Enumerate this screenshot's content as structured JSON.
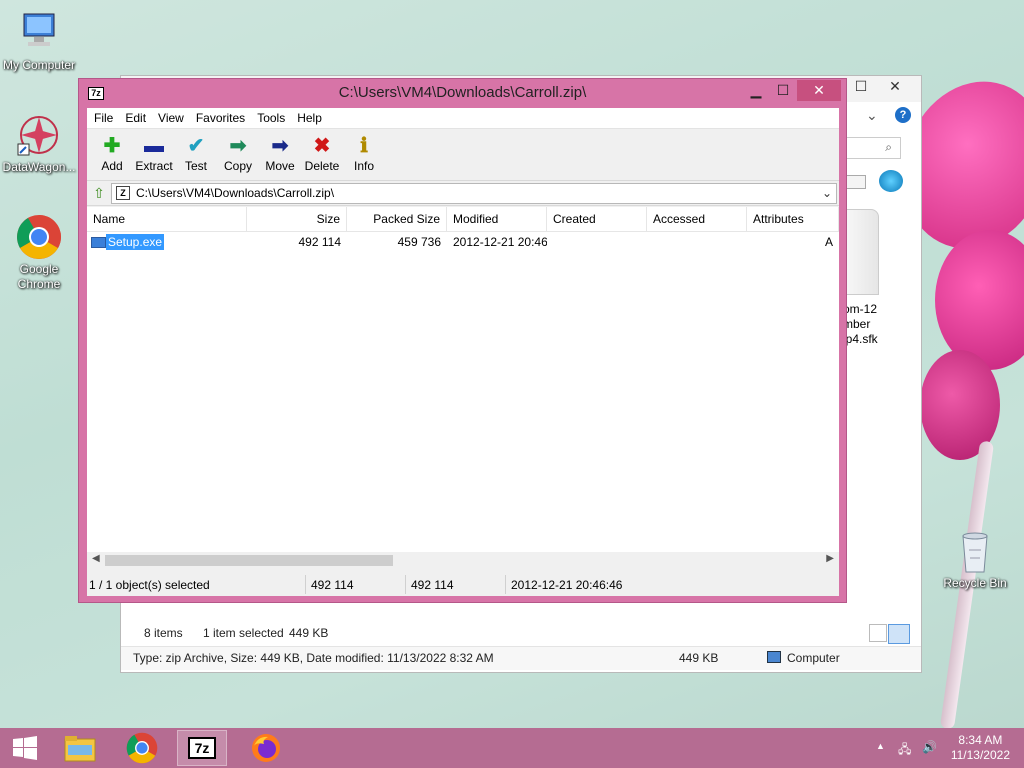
{
  "desktop": {
    "icons": [
      {
        "label": "My Computer",
        "icon": "computer-icon"
      },
      {
        "label": "DataWagon...",
        "icon": "datawagon-icon"
      },
      {
        "label": "Google Chrome",
        "icon": "chrome-icon"
      },
      {
        "label": "Recycle Bin",
        "icon": "recycle-bin-icon"
      }
    ]
  },
  "explorer": {
    "behind_text": [
      "om-12",
      "mber",
      "ip4.sfk"
    ],
    "status_items": "8 items",
    "status_selected": "1 item selected",
    "status_size": "449 KB",
    "details_text": "Type: zip Archive, Size: 449 KB, Date modified: 11/13/2022 8:32 AM",
    "details_size": "449 KB",
    "details_location": "Computer"
  },
  "zip": {
    "title": "C:\\Users\\VM4\\Downloads\\Carroll.zip\\",
    "menu": [
      "File",
      "Edit",
      "View",
      "Favorites",
      "Tools",
      "Help"
    ],
    "toolbar": [
      {
        "label": "Add",
        "icon": "add-icon",
        "glyph": "✚",
        "color": "#22aa22"
      },
      {
        "label": "Extract",
        "icon": "extract-icon",
        "glyph": "▬",
        "color": "#1a2a9a"
      },
      {
        "label": "Test",
        "icon": "test-icon",
        "glyph": "✔",
        "color": "#20a0c0"
      },
      {
        "label": "Copy",
        "icon": "copy-icon",
        "glyph": "➡",
        "color": "#1f8a5a"
      },
      {
        "label": "Move",
        "icon": "move-icon",
        "glyph": "➡",
        "color": "#1a2a8a"
      },
      {
        "label": "Delete",
        "icon": "delete-icon",
        "glyph": "✖",
        "color": "#d01818"
      },
      {
        "label": "Info",
        "icon": "info-icon",
        "glyph": "ℹ",
        "color": "#b08a00"
      }
    ],
    "address": "C:\\Users\\VM4\\Downloads\\Carroll.zip\\",
    "columns": [
      "Name",
      "Size",
      "Packed Size",
      "Modified",
      "Created",
      "Accessed",
      "Attributes"
    ],
    "rows": [
      {
        "name": "Setup.exe",
        "size": "492 114",
        "packed": "459 736",
        "modified": "2012-12-21 20:46",
        "created": "",
        "accessed": "",
        "attributes": "A"
      }
    ],
    "status": {
      "selected": "1 / 1 object(s) selected",
      "size": "492 114",
      "packed": "492 114",
      "modified": "2012-12-21 20:46:46"
    }
  },
  "taskbar": {
    "items": [
      "start-icon",
      "file-explorer-icon",
      "chrome-icon",
      "7zip-icon",
      "firefox-icon"
    ],
    "time": "8:34 AM",
    "date": "11/13/2022"
  }
}
